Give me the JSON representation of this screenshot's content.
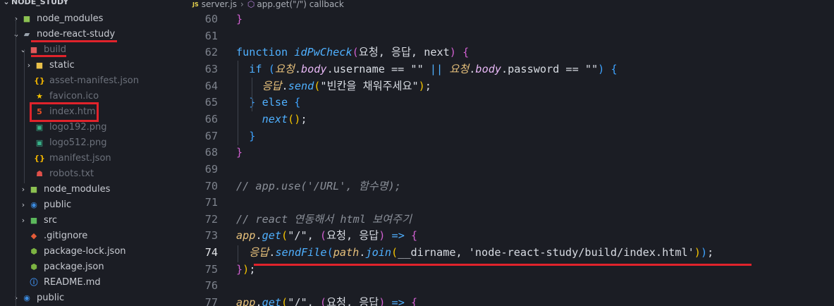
{
  "explorer": {
    "root_label": "NODE_STUDY",
    "items": [
      {
        "label": "node_modules",
        "type": "folder",
        "icon": "folder-node-icon",
        "expanded": false
      },
      {
        "label": "node-react-study",
        "type": "folder",
        "icon": "folder-open-icon",
        "expanded": true
      },
      {
        "label": "build",
        "type": "folder",
        "icon": "folder-build-icon",
        "expanded": true
      },
      {
        "label": "static",
        "type": "folder",
        "icon": "folder-yellow-icon",
        "expanded": false
      },
      {
        "label": "asset-manifest.json",
        "type": "file",
        "icon": "json-file-icon"
      },
      {
        "label": "favicon.ico",
        "type": "file",
        "icon": "star-icon"
      },
      {
        "label": "index.html",
        "type": "file",
        "icon": "html5-icon"
      },
      {
        "label": "logo192.png",
        "type": "file",
        "icon": "image-file-icon"
      },
      {
        "label": "logo512.png",
        "type": "file",
        "icon": "image-file-icon"
      },
      {
        "label": "manifest.json",
        "type": "file",
        "icon": "json-file-icon"
      },
      {
        "label": "robots.txt",
        "type": "file",
        "icon": "robot-icon"
      },
      {
        "label": "node_modules",
        "type": "folder",
        "icon": "folder-node-icon",
        "expanded": false
      },
      {
        "label": "public",
        "type": "folder",
        "icon": "folder-globe-icon",
        "expanded": false
      },
      {
        "label": "src",
        "type": "folder",
        "icon": "folder-src-icon",
        "expanded": false
      },
      {
        "label": ".gitignore",
        "type": "file",
        "icon": "git-icon"
      },
      {
        "label": "package-lock.json",
        "type": "file",
        "icon": "nodejs-file-icon"
      },
      {
        "label": "package.json",
        "type": "file",
        "icon": "nodejs-file-icon"
      },
      {
        "label": "README.md",
        "type": "file",
        "icon": "info-icon"
      },
      {
        "label": "public",
        "type": "folder",
        "icon": "folder-globe-icon",
        "expanded": false
      }
    ]
  },
  "breadcrumb": {
    "file": "server.js",
    "file_icon_text": "JS",
    "symbol": "app.get(\"/\") callback"
  },
  "editor": {
    "active_line": "74",
    "lines": [
      {
        "n": "60",
        "tokens": [
          [
            "}",
            "br2"
          ]
        ]
      },
      {
        "n": "61",
        "tokens": []
      },
      {
        "n": "62",
        "tokens": [
          [
            "function ",
            "kw"
          ],
          [
            "idPwCheck",
            "fn-i"
          ],
          [
            "(",
            "br2"
          ],
          [
            "요청, 응답, next",
            "var"
          ],
          [
            ")",
            "br2"
          ],
          [
            " {",
            "br2"
          ]
        ]
      },
      {
        "n": "63",
        "tokens": [
          [
            "  if ",
            "kw"
          ],
          [
            "(",
            "br3"
          ],
          [
            "요청",
            "var-i"
          ],
          [
            ".",
            "op"
          ],
          [
            "body",
            "prop-i"
          ],
          [
            ".username == \"\" ",
            "prop"
          ],
          [
            "|| ",
            "kw"
          ],
          [
            "요청",
            "var-i"
          ],
          [
            ".",
            "op"
          ],
          [
            "body",
            "prop-i"
          ],
          [
            ".password == \"\"",
            "prop"
          ],
          [
            ") ",
            "br3"
          ],
          [
            "{",
            "br3"
          ]
        ]
      },
      {
        "n": "64",
        "tokens": [
          [
            "    ",
            "dflt"
          ],
          [
            "응답",
            "var-i"
          ],
          [
            ".",
            "op"
          ],
          [
            "send",
            "fn-i"
          ],
          [
            "(",
            "br1"
          ],
          [
            "\"빈칸을 채워주세요\"",
            "strc"
          ],
          [
            ")",
            "br1"
          ],
          [
            ";",
            "op"
          ]
        ]
      },
      {
        "n": "65",
        "tokens": [
          [
            "  } ",
            "br3"
          ],
          [
            "else ",
            "kw"
          ],
          [
            "{",
            "br3"
          ]
        ]
      },
      {
        "n": "66",
        "tokens": [
          [
            "    ",
            "dflt"
          ],
          [
            "next",
            "fn-i"
          ],
          [
            "()",
            "br1"
          ],
          [
            ";",
            "op"
          ]
        ]
      },
      {
        "n": "67",
        "tokens": [
          [
            "  }",
            "br3"
          ]
        ]
      },
      {
        "n": "68",
        "tokens": [
          [
            "}",
            "br2"
          ]
        ]
      },
      {
        "n": "69",
        "tokens": []
      },
      {
        "n": "70",
        "tokens": [
          [
            "// app.use('/URL', 함수명);",
            "cmt"
          ]
        ]
      },
      {
        "n": "71",
        "tokens": []
      },
      {
        "n": "72",
        "tokens": [
          [
            "// react 연동해서 html 보여주기",
            "cmt"
          ]
        ]
      },
      {
        "n": "73",
        "tokens": [
          [
            "app",
            "var-i"
          ],
          [
            ".",
            "op"
          ],
          [
            "get",
            "fn-i"
          ],
          [
            "(",
            "br1"
          ],
          [
            "\"/\", ",
            "str"
          ],
          [
            "(",
            "br2"
          ],
          [
            "요청, 응답",
            "var"
          ],
          [
            ") ",
            "br2"
          ],
          [
            "=> ",
            "kw"
          ],
          [
            "{",
            "br2"
          ]
        ]
      },
      {
        "n": "74",
        "tokens": [
          [
            "  ",
            "dflt"
          ],
          [
            "응답",
            "var-i"
          ],
          [
            ".",
            "op"
          ],
          [
            "sendFile",
            "fn-i"
          ],
          [
            "(",
            "br3"
          ],
          [
            "path",
            "var-i"
          ],
          [
            ".",
            "op"
          ],
          [
            "join",
            "fn-i"
          ],
          [
            "(",
            "br1"
          ],
          [
            "__dirname, 'node-react-study/build/index.html'",
            "str"
          ],
          [
            ")",
            "br1"
          ],
          [
            ")",
            "br3"
          ],
          [
            ";",
            "op"
          ]
        ]
      },
      {
        "n": "75",
        "tokens": [
          [
            "}",
            "br2"
          ],
          [
            ")",
            "br1"
          ],
          [
            ";",
            "op"
          ]
        ]
      },
      {
        "n": "76",
        "tokens": []
      },
      {
        "n": "77",
        "tokens": [
          [
            "app",
            "var-i"
          ],
          [
            ".",
            "op"
          ],
          [
            "get",
            "fn-i"
          ],
          [
            "(",
            "br1"
          ],
          [
            "\"/\", ",
            "str"
          ],
          [
            "(",
            "br2"
          ],
          [
            "요청, 응답",
            "var"
          ],
          [
            ") ",
            "br2"
          ],
          [
            "=> ",
            "kw"
          ],
          [
            "{",
            "br2"
          ]
        ]
      }
    ]
  },
  "colors": {
    "annotation_red": "#e0232b",
    "explorer_bg": "#1b1d24",
    "editor_bg": "#1b1d24"
  }
}
